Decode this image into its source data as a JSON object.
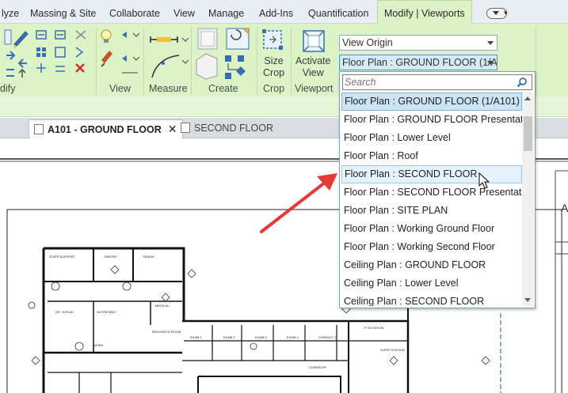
{
  "ribbon_tabs": [
    {
      "label": "lyze"
    },
    {
      "label": "Massing & Site"
    },
    {
      "label": "Collaborate"
    },
    {
      "label": "View"
    },
    {
      "label": "Manage"
    },
    {
      "label": "Add-Ins"
    },
    {
      "label": "Quantification"
    },
    {
      "label": "Modify | Viewports"
    }
  ],
  "panels": {
    "modify": "dify",
    "view": "View",
    "measure": "Measure",
    "create": "Create",
    "crop": "Crop",
    "viewport": "Viewport"
  },
  "buttons": {
    "size_crop_line1": "Size",
    "size_crop_line2": "Crop",
    "activate_view_line1": "Activate",
    "activate_view_line2": "View"
  },
  "combos": {
    "view_origin": "View Origin",
    "view_selector": "Floor Plan : GROUND FLOOR (1/A..."
  },
  "view_tabs": [
    {
      "label": "A101 - GROUND FLOOR",
      "active": true
    },
    {
      "label": "SECOND FLOOR",
      "active": false
    }
  ],
  "dropdown": {
    "search_placeholder": "Search",
    "items": [
      "Floor Plan : GROUND FLOOR (1/A101)",
      "Floor Plan : GROUND FLOOR Presentation",
      "Floor Plan : Lower Level",
      "Floor Plan : Roof",
      "Floor Plan : SECOND FLOOR",
      "Floor Plan : SECOND FLOOR Presentation",
      "Floor Plan : SITE PLAN",
      "Floor Plan : Working Ground Floor",
      "Floor Plan : Working Second Floor",
      "Ceiling Plan : GROUND FLOOR",
      "Ceiling Plan : Lower Level",
      "Ceiling Plan : SECOND FLOOR"
    ],
    "selected_index": 0,
    "hover_index": 4
  },
  "colors": {
    "ribbon_green": "#dcf3c7",
    "selection_blue": "#cde4f7",
    "arrow_red": "#e53935"
  }
}
